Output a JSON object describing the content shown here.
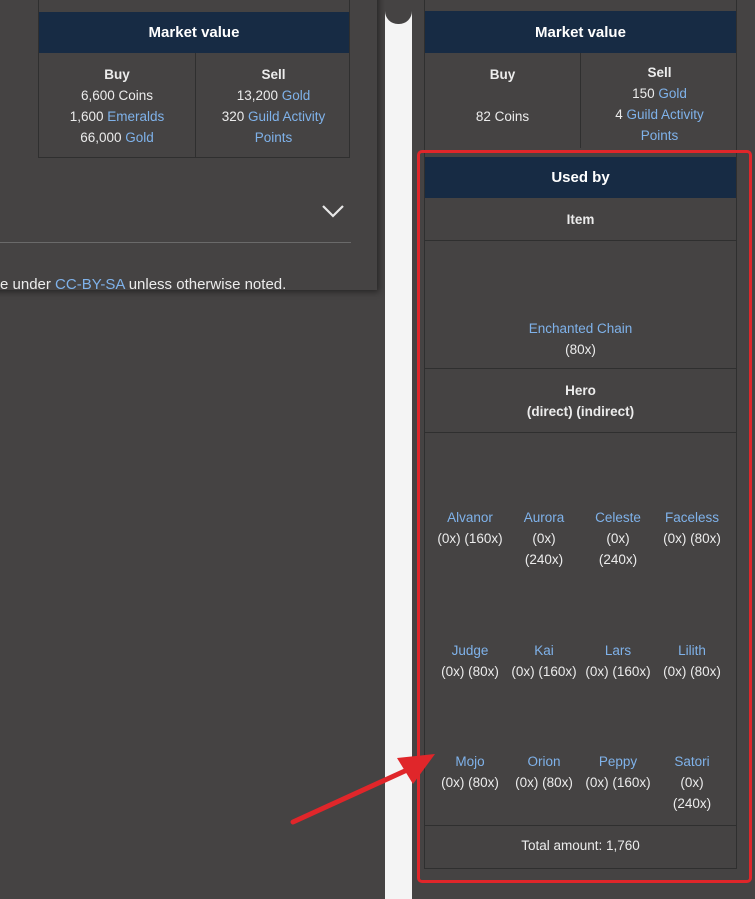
{
  "left": {
    "market_value": {
      "title": "Market value",
      "buy": {
        "header": "Buy",
        "lines": [
          {
            "amount": "6,600",
            "unit": "Coins",
            "unit_is_link": false
          },
          {
            "amount": "1,600",
            "unit": "Emeralds",
            "unit_is_link": true
          },
          {
            "amount": "66,000",
            "unit": "Gold",
            "unit_is_link": true
          }
        ]
      },
      "sell": {
        "header": "Sell",
        "line1_amount": "13,200",
        "line1_unit": "Gold",
        "line2_amount": "320",
        "line2_unit_a": "Guild Activity",
        "line2_unit_b": "Points"
      }
    },
    "expand_icon": "chevron-down-icon",
    "license": {
      "prefix": "e under ",
      "link": "CC-BY-SA",
      "suffix": " unless otherwise noted."
    }
  },
  "right": {
    "market_value": {
      "title": "Market value",
      "buy": {
        "header": "Buy",
        "value": "82 Coins"
      },
      "sell": {
        "header": "Sell",
        "line1_amount": "150",
        "line1_unit": "Gold",
        "line2_amount": "4",
        "line2_unit_a": "Guild Activity",
        "line2_unit_b": "Points"
      }
    },
    "used_by": {
      "title": "Used by",
      "item_header": "Item",
      "item_name": "Enchanted Chain",
      "item_qty": "(80x)",
      "hero_header": "Hero",
      "hero_subheader": "(direct) (indirect)",
      "heroes": [
        {
          "name": "Alvanor",
          "l1": "(0x) (160x)",
          "l2": ""
        },
        {
          "name": "Aurora",
          "l1": "(0x)",
          "l2": "(240x)"
        },
        {
          "name": "Celeste",
          "l1": "(0x)",
          "l2": "(240x)"
        },
        {
          "name": "Faceless",
          "l1": "(0x) (80x)",
          "l2": ""
        },
        {
          "name": "Judge",
          "l1": "(0x) (80x)",
          "l2": ""
        },
        {
          "name": "Kai",
          "l1": "(0x) (160x)",
          "l2": ""
        },
        {
          "name": "Lars",
          "l1": "(0x) (160x)",
          "l2": ""
        },
        {
          "name": "Lilith",
          "l1": "(0x) (80x)",
          "l2": ""
        },
        {
          "name": "Mojo",
          "l1": "(0x) (80x)",
          "l2": ""
        },
        {
          "name": "Orion",
          "l1": "(0x) (80x)",
          "l2": ""
        },
        {
          "name": "Peppy",
          "l1": "(0x) (160x)",
          "l2": ""
        },
        {
          "name": "Satori",
          "l1": "(0x)",
          "l2": "(240x)"
        }
      ],
      "total": "Total amount: 1,760"
    }
  },
  "annotation": {
    "highlight_color": "#e0262a",
    "arrow_color": "#e0262a"
  }
}
